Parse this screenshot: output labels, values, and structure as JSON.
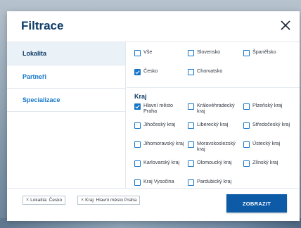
{
  "modal": {
    "title": "Filtrace",
    "close_icon": "close-icon"
  },
  "sidebar": {
    "items": [
      {
        "label": "Lokalita",
        "active": true
      },
      {
        "label": "Partneři",
        "active": false
      },
      {
        "label": "Specializace",
        "active": false
      }
    ]
  },
  "countries": [
    {
      "label": "Vše",
      "checked": false
    },
    {
      "label": "Slovensko",
      "checked": false
    },
    {
      "label": "Španělsko",
      "checked": false
    },
    {
      "label": "Česko",
      "checked": true
    },
    {
      "label": "Chorvatsko",
      "checked": false
    }
  ],
  "region_section_title": "Kraj",
  "regions": [
    {
      "label": "Hlavní město Praha",
      "checked": true
    },
    {
      "label": "Královéhradecký kraj",
      "checked": false
    },
    {
      "label": "Plzeňský kraj",
      "checked": false
    },
    {
      "label": "Jihočeský kraj",
      "checked": false
    },
    {
      "label": "Liberecký kraj",
      "checked": false
    },
    {
      "label": "Středočeský kraj",
      "checked": false
    },
    {
      "label": "Jihomoravský kraj",
      "checked": false
    },
    {
      "label": "Moravskoslezský kraj",
      "checked": false
    },
    {
      "label": "Ústecký kraj",
      "checked": false
    },
    {
      "label": "Karlovarský kraj",
      "checked": false
    },
    {
      "label": "Olomoucký kraj",
      "checked": false
    },
    {
      "label": "Zlínský kraj",
      "checked": false
    },
    {
      "label": "Kraj Vysočina",
      "checked": false
    },
    {
      "label": "Pardubický kraj",
      "checked": false
    }
  ],
  "footer": {
    "chips": [
      {
        "x": "×",
        "label": "Lokalita: Česko"
      },
      {
        "x": "×",
        "label": "Kraj: Hlavní město Praha"
      }
    ],
    "submit_label": "ZOBRAZIT"
  },
  "colors": {
    "brand_dark": "#0d3b66",
    "accent": "#1677c9",
    "button": "#0d5aa7"
  }
}
